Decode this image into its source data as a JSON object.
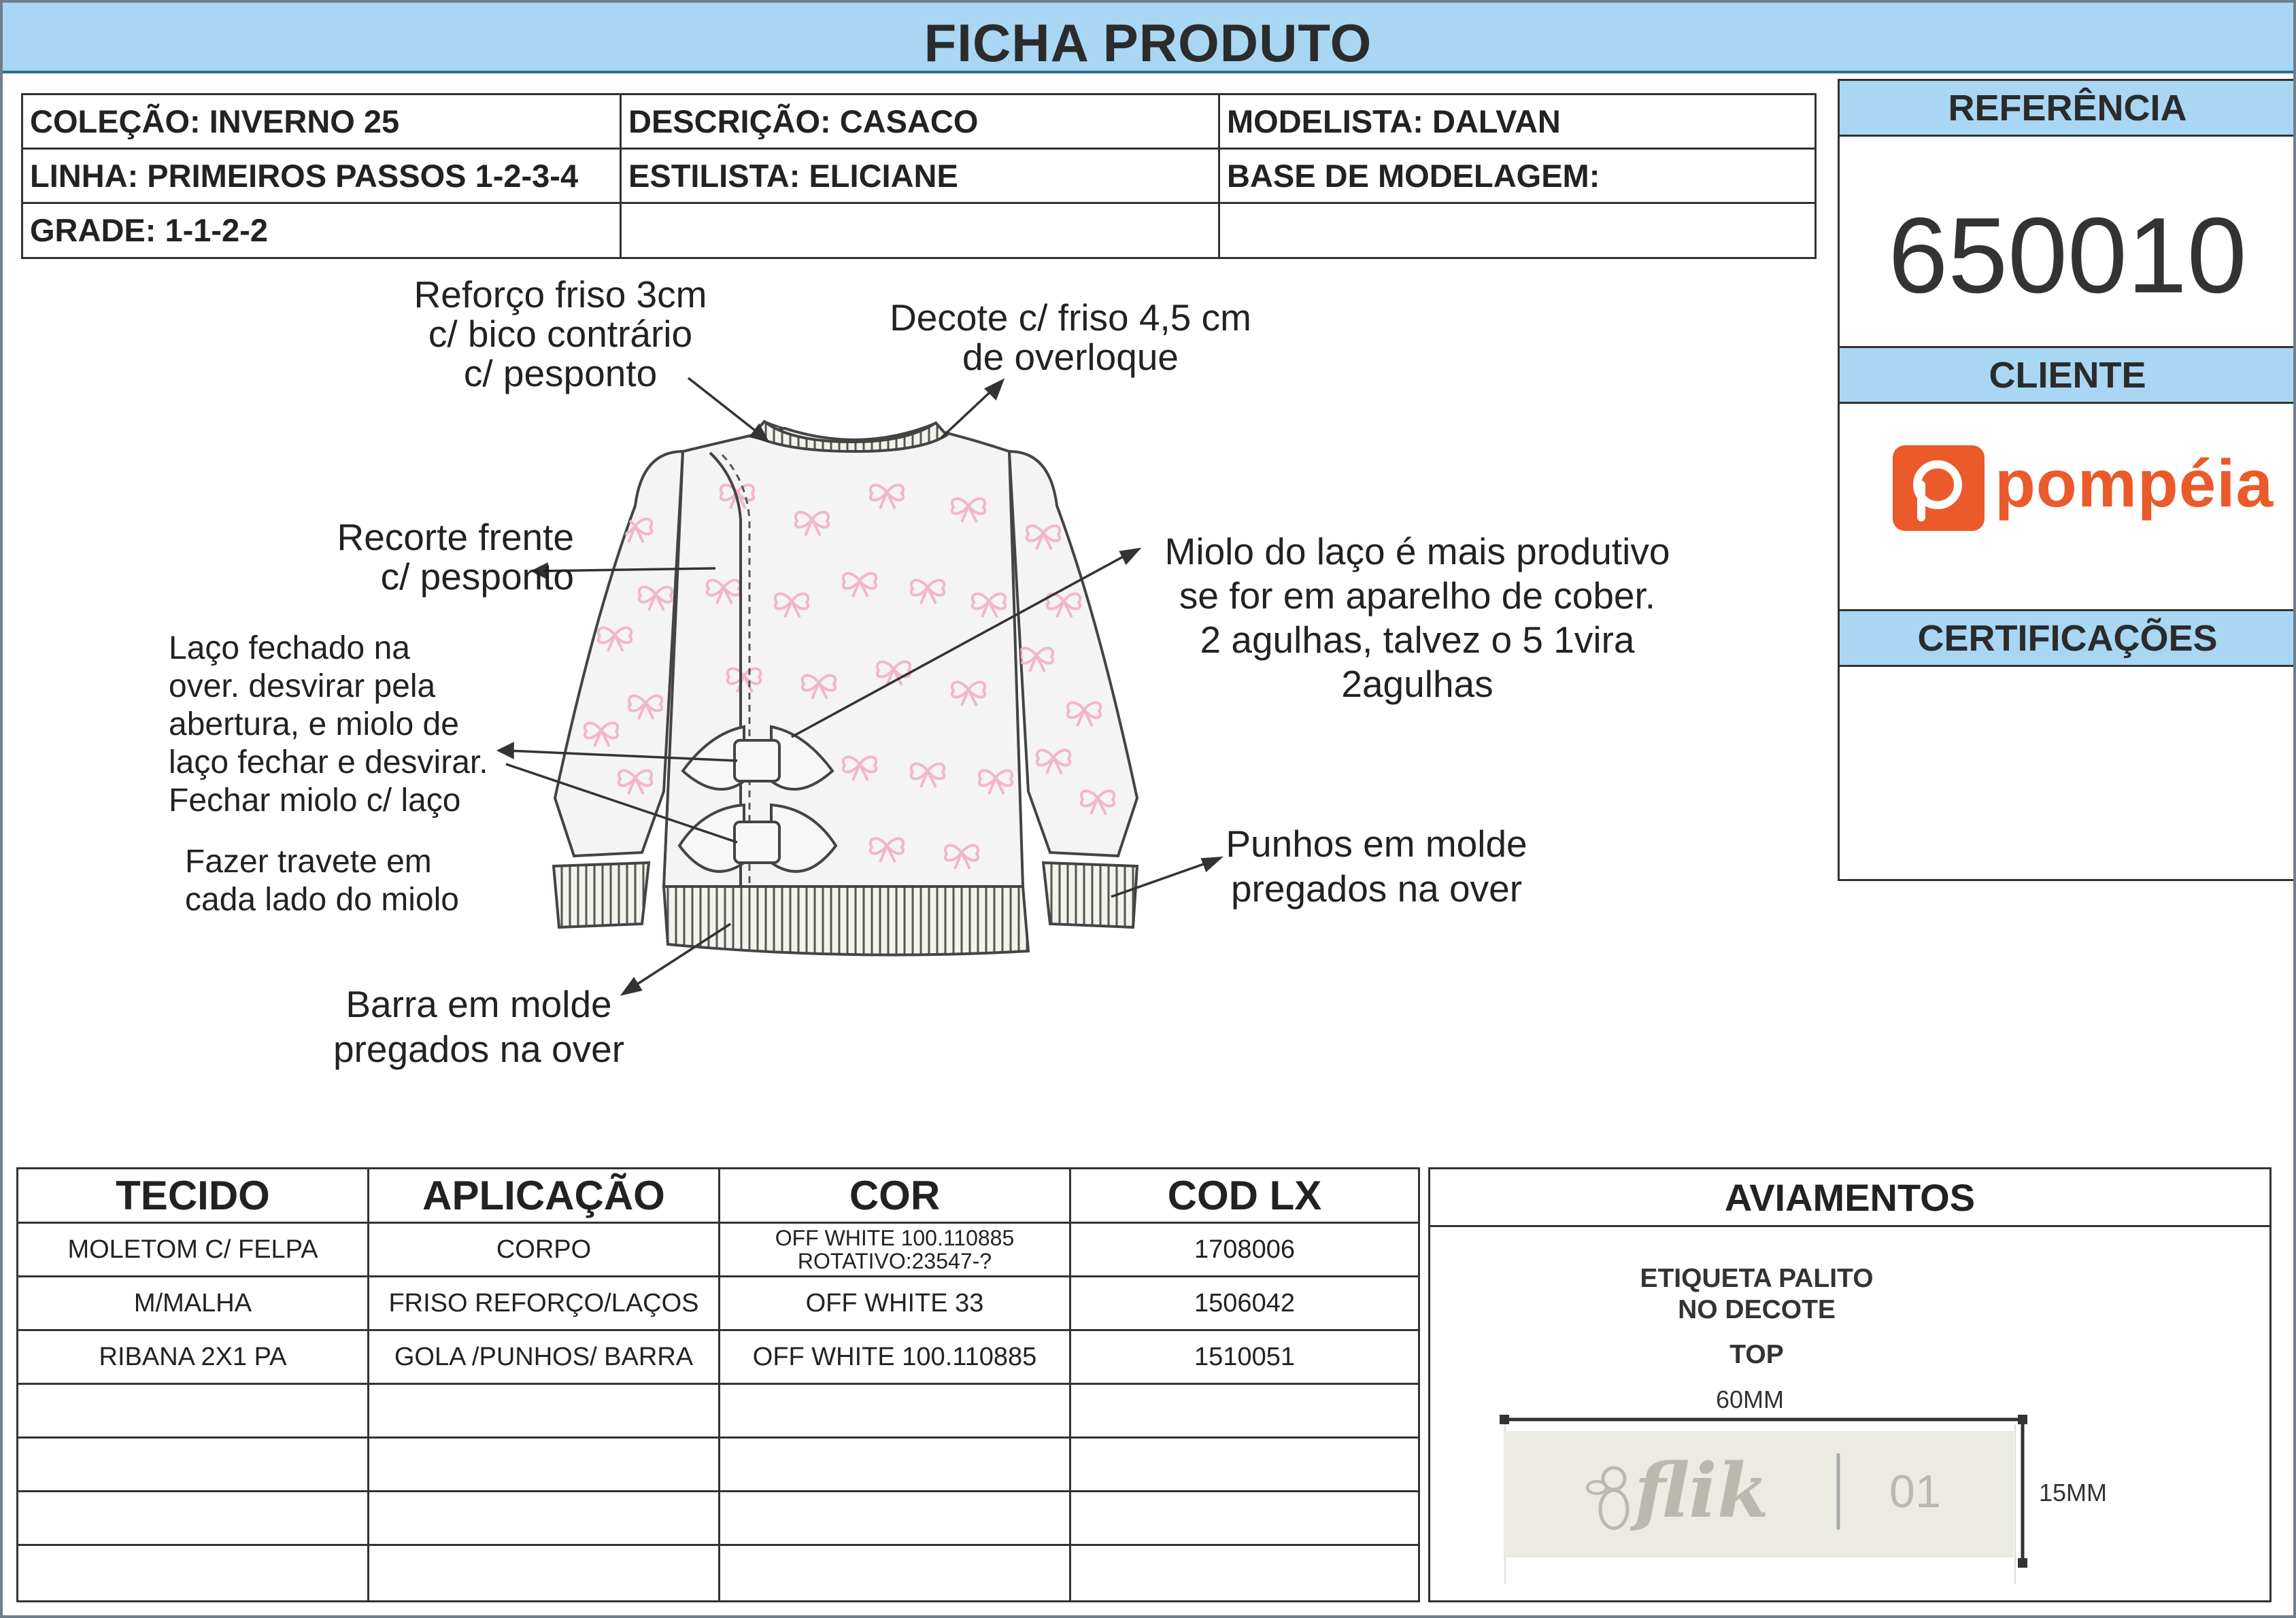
{
  "header": {
    "title": "FICHA PRODUTO"
  },
  "info": {
    "colecao": "COLEÇÃO: INVERNO 25",
    "descricao": "DESCRIÇÃO: CASACO",
    "modelista": "MODELISTA: DALVAN",
    "linha": "LINHA: PRIMEIROS PASSOS 1-2-3-4",
    "estilista": "ESTILISTA: ELICIANE",
    "base": "BASE DE MODELAGEM:",
    "grade": "GRADE: 1-1-2-2"
  },
  "side": {
    "referencia_label": "REFERÊNCIA",
    "referencia_value": "650010",
    "cliente_label": "CLIENTE",
    "cliente_logo": "pompéia",
    "certificacoes_label": "CERTIFICAÇÕES"
  },
  "annotations": {
    "reforco": [
      "Reforço friso 3cm",
      "c/ bico contrário",
      "c/ pesponto"
    ],
    "decote": [
      "Decote c/ friso 4,5 cm",
      "de overloque"
    ],
    "recorte": [
      "Recorte frente",
      "c/ pesponto"
    ],
    "miolo": [
      "Miolo do laço é mais produtivo",
      "se for em aparelho de cober.",
      "2 agulhas, talvez o 5 1vira",
      "2agulhas"
    ],
    "laco": [
      "Laço fechado na",
      "over. desvirar pela",
      "abertura, e miolo de",
      "laço fechar e desvirar.",
      "Fechar miolo c/ laço"
    ],
    "travete": [
      "Fazer travete em",
      "cada lado do miolo"
    ],
    "punhos": [
      "Punhos em molde",
      "pregados na over"
    ],
    "barra": [
      "Barra em molde",
      "pregados na over"
    ]
  },
  "materials": {
    "headers": [
      "TECIDO",
      "APLICAÇÃO",
      "COR",
      "COD LX"
    ],
    "rows": [
      {
        "tecido": "MOLETOM C/ FELPA",
        "aplicacao": "CORPO",
        "cor1": "OFF WHITE 100.110885",
        "cor2": "ROTATIVO:23547-?",
        "cod": "1708006"
      },
      {
        "tecido": "M/MALHA",
        "aplicacao": "FRISO REFORÇO/LAÇOS",
        "cor1": "OFF WHITE 33",
        "cor2": "",
        "cod": "1506042"
      },
      {
        "tecido": "RIBANA 2X1 PA",
        "aplicacao": "GOLA /PUNHOS/ BARRA",
        "cor1": "OFF WHITE 100.110885",
        "cor2": "",
        "cod": "1510051"
      }
    ],
    "empty_rows": 4
  },
  "aviamentos": {
    "title": "AVIAMENTOS",
    "line1": "ETIQUETA PALITO",
    "line2": "NO DECOTE",
    "line3": "TOP",
    "width_label": "60MM",
    "height_label": "15MM",
    "label_brand": "flik",
    "label_number": "01"
  },
  "colors": {
    "header_blue": "#a8d6f3",
    "border": "#333333",
    "pompeia_orange": "#ea5a2a",
    "bow_pink": "#f2b6cc"
  }
}
